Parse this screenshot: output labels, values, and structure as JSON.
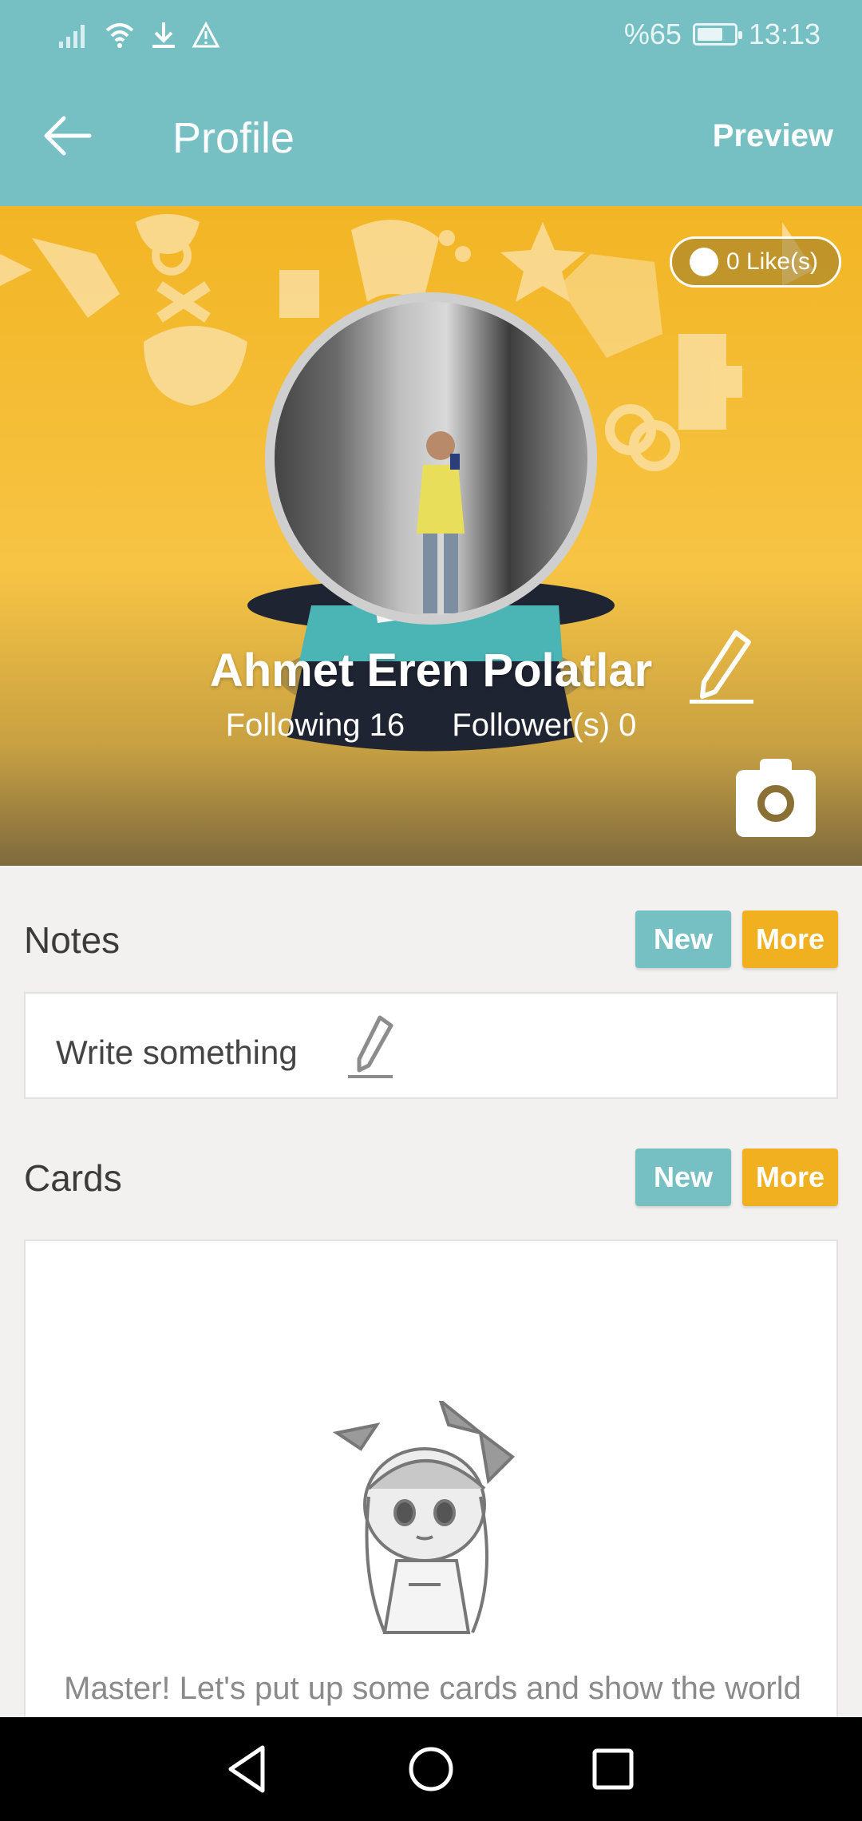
{
  "status_bar": {
    "battery_text": "%65",
    "time": "13:13",
    "icons": [
      "signal-icon",
      "wifi-icon",
      "download-icon",
      "warning-icon",
      "battery-icon"
    ]
  },
  "app_bar": {
    "title": "Profile",
    "back_icon": "arrow-left-icon",
    "preview_label": "Preview"
  },
  "profile": {
    "likes_label": "0 Like(s)",
    "name": "Ahmet Eren Polatlar",
    "following_label": "Following 16",
    "followers_label": "Follower(s) 0"
  },
  "notes": {
    "title": "Notes",
    "new_label": "New",
    "more_label": "More",
    "placeholder": "Write something"
  },
  "cards": {
    "title": "Cards",
    "new_label": "New",
    "more_label": "More",
    "empty_text": "Master! Let's put up some cards and show the world"
  },
  "colors": {
    "teal": "#76c0c4",
    "orange": "#f0b020",
    "hero_yellow": "#f5be38",
    "background": "#f2f1ef"
  }
}
